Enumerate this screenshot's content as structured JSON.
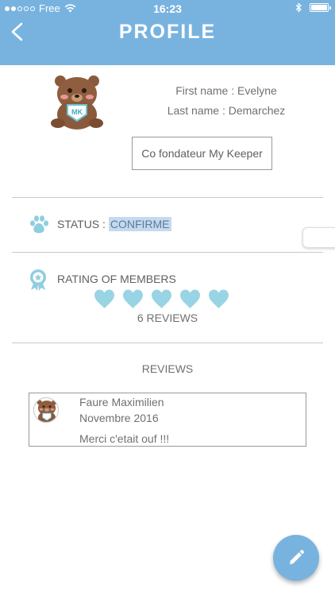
{
  "statusbar": {
    "carrier": "Free",
    "time": "16:23",
    "signal_bars": 2,
    "battery_level": 1.0
  },
  "header": {
    "title": "PROFILE",
    "back_icon": "chevron-left-icon",
    "color": "#78b3e0"
  },
  "profile": {
    "first_name_line": "First name : Evelyne",
    "last_name_line": "Last name : Demarchez",
    "role": "Co fondateur My Keeper",
    "avatar_badge": "MK"
  },
  "status": {
    "icon": "paw-icon",
    "label": "STATUS : ",
    "value": "CONFIRME"
  },
  "rating": {
    "icon": "award-badge-icon",
    "label": "RATING OF MEMBERS",
    "hearts_filled": 5,
    "hearts_total": 5,
    "reviews_count": "6 REVIEWS",
    "heart_color": "#99d4e4"
  },
  "reviews": {
    "title": "REVIEWS",
    "items": [
      {
        "name": "Faure Maximilien",
        "date": "Novembre 2016",
        "text": "Merci c'etait ouf !!!"
      }
    ]
  },
  "fab": {
    "icon": "pencil-icon"
  }
}
